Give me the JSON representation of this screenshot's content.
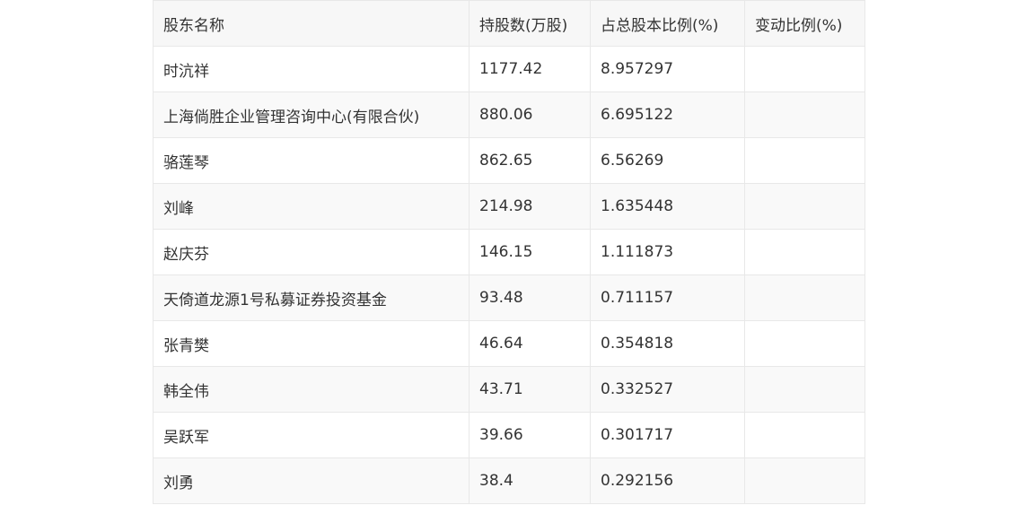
{
  "table": {
    "headers": [
      "股东名称",
      "持股数(万股)",
      "占总股本比例(%)",
      "变动比例(%)"
    ],
    "rows": [
      [
        "时沆祥",
        "1177.42",
        "8.957297",
        ""
      ],
      [
        "上海倘胜企业管理咨询中心(有限合伙)",
        "880.06",
        "6.695122",
        ""
      ],
      [
        "骆莲琴",
        "862.65",
        "6.56269",
        ""
      ],
      [
        "刘峰",
        "214.98",
        "1.635448",
        ""
      ],
      [
        "赵庆芬",
        "146.15",
        "1.111873",
        ""
      ],
      [
        "天倚道龙源1号私募证券投资基金",
        "93.48",
        "0.711157",
        ""
      ],
      [
        "张青樊",
        "46.64",
        "0.354818",
        ""
      ],
      [
        "韩全伟",
        "43.71",
        "0.332527",
        ""
      ],
      [
        "吴跃军",
        "39.66",
        "0.301717",
        ""
      ],
      [
        "刘勇",
        "38.4",
        "0.292156",
        ""
      ]
    ]
  }
}
